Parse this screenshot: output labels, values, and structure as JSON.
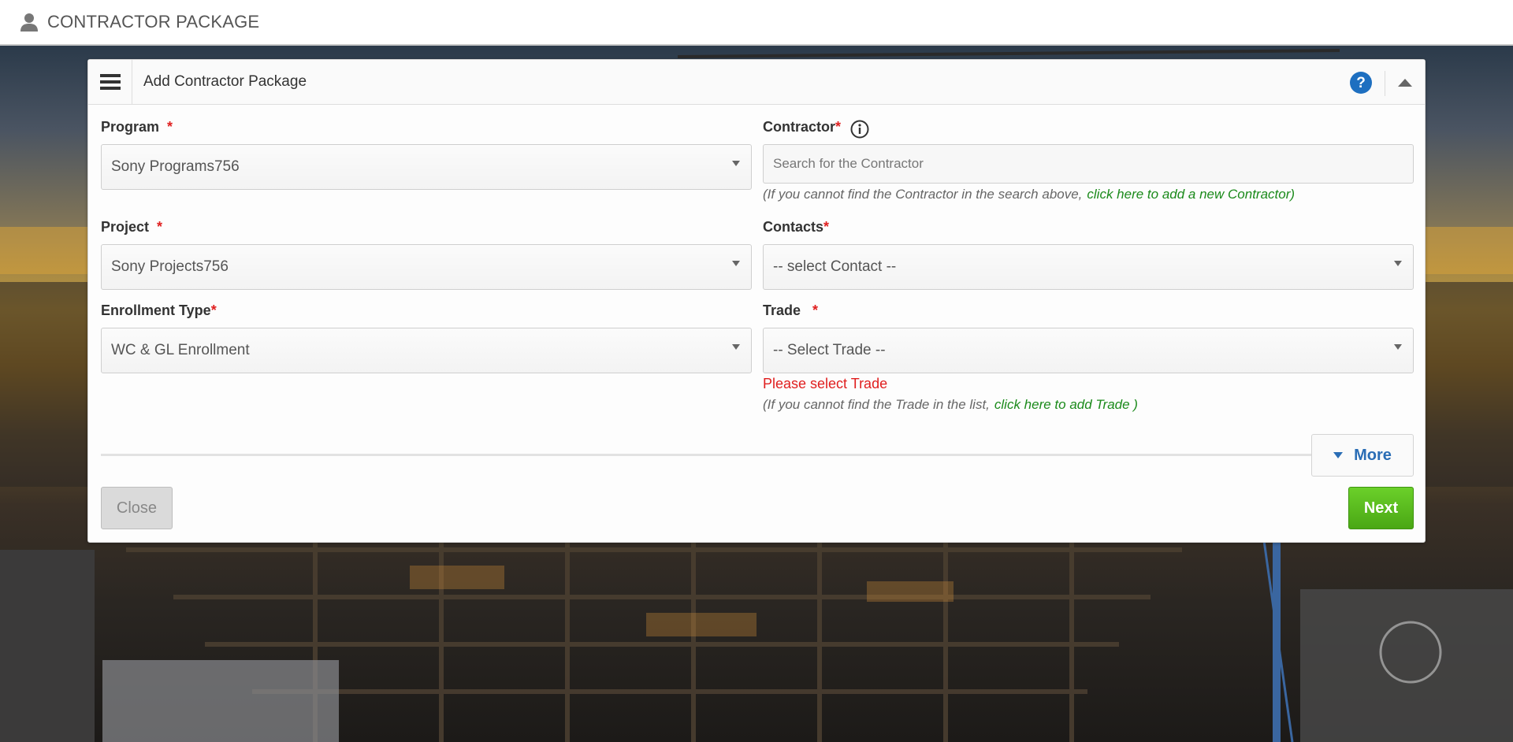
{
  "header": {
    "title": "CONTRACTOR PACKAGE",
    "icon": "user-icon"
  },
  "panel": {
    "title": "Add Contractor Package",
    "icons": {
      "menu": "hamburger-menu-icon",
      "help": "help-icon",
      "collapse": "chevron-up-icon"
    }
  },
  "colors": {
    "required": "#e02020",
    "link": "#1a8a1a",
    "error": "#e01e1e",
    "next": "#4aa714",
    "more": "#2a6db5"
  },
  "form": {
    "program": {
      "label": "Program",
      "required_mark": "*",
      "value": "Sony Programs756"
    },
    "project": {
      "label": "Project",
      "required_mark": "*",
      "value": "Sony Projects756"
    },
    "enrollment_type": {
      "label": "Enrollment Type",
      "required_mark": "*",
      "value": "WC & GL Enrollment"
    },
    "contractor": {
      "label": "Contractor",
      "required_mark": "*",
      "placeholder": "Search for the Contractor",
      "hint": "(If you cannot find the Contractor in the search above,",
      "hint_link": "click here to add a new Contractor)"
    },
    "contacts": {
      "label": "Contacts",
      "required_mark": "*",
      "value": "-- select Contact --"
    },
    "trade": {
      "label": "Trade",
      "required_mark": "*",
      "value": "-- Select Trade --",
      "error": "Please select Trade",
      "hint": "(If you cannot find the Trade in the list,",
      "hint_link": "click here to add Trade )"
    }
  },
  "buttons": {
    "more": "More",
    "close": "Close",
    "next": "Next"
  }
}
